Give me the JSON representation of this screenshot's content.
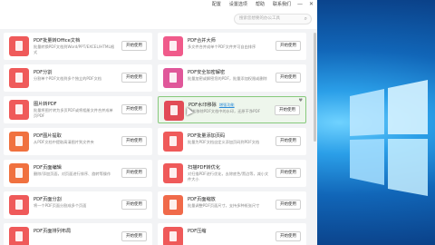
{
  "topbar": {
    "menus": [
      "配置",
      "设置选项",
      "帮助",
      "联系我们"
    ],
    "win_buttons": [
      "—",
      "✕"
    ]
  },
  "search": {
    "placeholder": "搜索您想要的办公工具"
  },
  "colors": {
    "active_card_border": "#87c97c",
    "link": "#2a8bd8"
  },
  "cards": [
    {
      "title": "PDF批量转Office文档",
      "desc": "批量转换PDF文档到Word/PPT/EXCEL/HTML格式",
      "button": "开始使用",
      "icon": "pdf-to-office-icon",
      "color": "#ef5a5a"
    },
    {
      "title": "PDF合并大师",
      "desc": "多文件合并成单个PDF文件并可自由排序",
      "button": "开始使用",
      "icon": "pdf-merge-icon",
      "color": "#f05b8b"
    },
    {
      "title": "PDF分割",
      "desc": "分割单个PDF文档到多个独立的PDF文档",
      "button": "开始使用",
      "icon": "pdf-split-icon",
      "color": "#ef5a5a"
    },
    {
      "title": "PDF安全加密解密",
      "desc": "批量加密或解密您的PDF，批量添加权限或删除",
      "button": "开始使用",
      "icon": "pdf-encrypt-icon",
      "color": "#e0579a"
    },
    {
      "title": "图片转PDF",
      "desc": "批量将图片转为多页PDF或将相册文件合并成单页PDF",
      "button": "开始使用",
      "icon": "image-to-pdf-icon",
      "color": "#ef5a5a"
    },
    {
      "title": "PDF水印移除",
      "tag": "增强功能",
      "desc": "轻松移除PDF文档中的水印，还原干净PDF",
      "button": "开始使用",
      "icon": "watermark-remove-icon",
      "color": "#e24b56",
      "fav": "♥"
    },
    {
      "title": "PDF图片提取",
      "desc": "从PDF文档中提取高清图片到文件夹",
      "button": "开始使用",
      "icon": "pdf-image-extract-icon",
      "color": "#f0713f"
    },
    {
      "title": "PDF批量添加页码",
      "desc": "批量为PDF文档自定义添加页码到PDF文档",
      "button": "开始使用",
      "icon": "pdf-page-number-icon",
      "color": "#ef5a5a"
    },
    {
      "title": "PDF页面编辑",
      "desc": "删除/添加页面，对页面进行排序、旋转等操作",
      "button": "开始使用",
      "icon": "pdf-page-edit-icon",
      "color": "#f0713f"
    },
    {
      "title": "扫描PDF转优化",
      "desc": "对扫描PDF进行优化，去除底色/黑边等，减小文件大小",
      "button": "开始使用",
      "icon": "scan-pdf-optimize-icon",
      "color": "#ef5a5a"
    },
    {
      "title": "PDF页面分割",
      "desc": "将一个PDF页面分割成多个页面",
      "button": "开始使用",
      "icon": "pdf-page-split-icon",
      "color": "#ef5a5a"
    },
    {
      "title": "PDF页面缩放",
      "desc": "批量调整PDF页面尺寸，支持多种纸张尺寸",
      "button": "开始使用",
      "icon": "pdf-page-scale-icon",
      "color": "#f06a4a"
    },
    {
      "title": "PDF页面排列布局",
      "desc": "",
      "button": "开始使用",
      "icon": "pdf-layout-icon",
      "color": "#ef5a5a"
    },
    {
      "title": "PDF压缩",
      "desc": "",
      "button": "开始使用",
      "icon": "pdf-compress-icon",
      "color": "#ef5a5a"
    }
  ]
}
